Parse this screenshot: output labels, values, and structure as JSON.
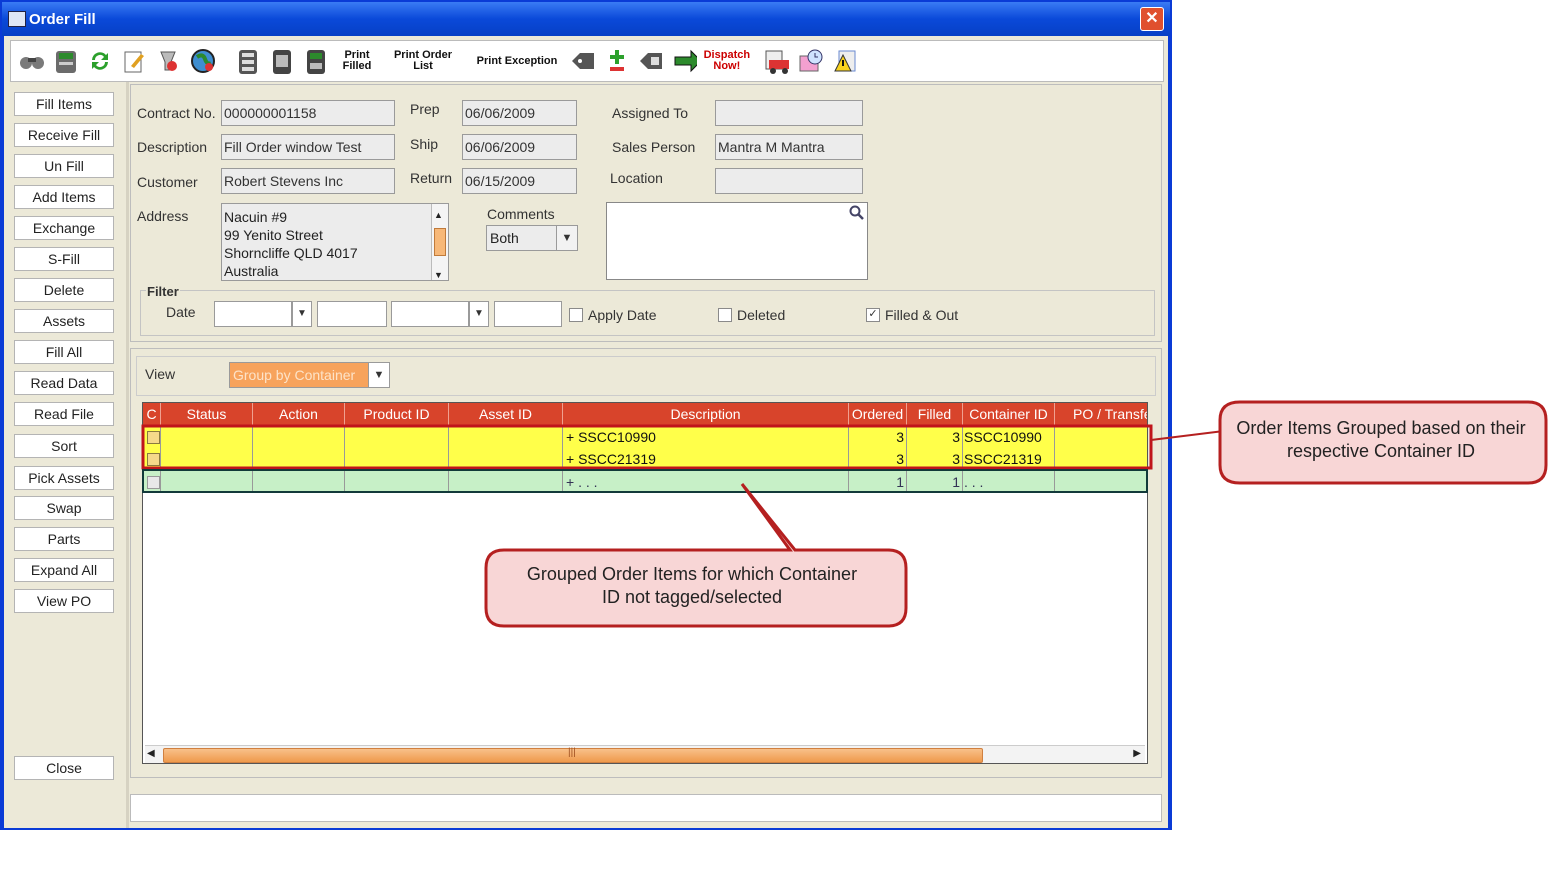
{
  "window": {
    "title": "Order Fill",
    "close_label": "✕"
  },
  "toolbar": {
    "print_filled": "Print Filled",
    "print_order_list": "Print Order List",
    "print_exception": "Print Exception",
    "dispatch_now": "Dispatch Now!"
  },
  "sidebar": {
    "fill_items": "Fill Items",
    "receive_fill": "Receive Fill",
    "un_fill": "Un Fill",
    "add_items": "Add Items",
    "exchange": "Exchange",
    "s_fill": "S-Fill",
    "delete": "Delete",
    "assets": "Assets",
    "fill_all": "Fill  All",
    "read_data": "Read Data",
    "read_file": "Read File",
    "sort": "Sort",
    "pick_assets": "Pick Assets",
    "swap": "Swap",
    "parts": "Parts",
    "expand_all": "Expand All",
    "view_po": "View PO",
    "close": "Close"
  },
  "form": {
    "contract_no_label": "Contract No.",
    "contract_no": "000000001158",
    "description_label": "Description",
    "description": "Fill Order window Test",
    "customer_label": "Customer",
    "customer": "Robert Stevens Inc",
    "address_label": "Address",
    "address_lines": [
      "Nacuin #9",
      "99 Yenito Street",
      "Shorncliffe QLD 4017",
      "Australia"
    ],
    "prep_label": "Prep",
    "prep": "06/06/2009",
    "ship_label": "Ship",
    "ship": "06/06/2009",
    "return_label": "Return",
    "return": "06/15/2009",
    "comments_label": "Comments",
    "comments_select": "Both",
    "assigned_to_label": "Assigned To",
    "assigned_to": "",
    "sales_person_label": "Sales Person",
    "sales_person": "Mantra M Mantra",
    "location_label": "Location",
    "location": ""
  },
  "filter": {
    "title": "Filter",
    "date_label": "Date",
    "apply_date": "Apply Date",
    "apply_date_checked": false,
    "deleted": "Deleted",
    "deleted_checked": false,
    "filled_out": "Filled & Out",
    "filled_out_checked": true
  },
  "view": {
    "label": "View",
    "selected": "Group by Container"
  },
  "grid": {
    "columns": [
      "C",
      "Status",
      "Action",
      "Product ID",
      "Asset ID",
      "Description",
      "Ordered",
      "Filled",
      "Container ID",
      "PO / Transfer"
    ],
    "rows": [
      {
        "description": "+ SSCC10990",
        "ordered": "3",
        "filled": "3",
        "container_id": "SSCC10990"
      },
      {
        "description": "+ SSCC21319",
        "ordered": "3",
        "filled": "3",
        "container_id": "SSCC21319"
      },
      {
        "description": "+ . . .",
        "ordered": "1",
        "filled": "1",
        "container_id": ". . ."
      }
    ],
    "scroll_grip": "|||"
  },
  "callouts": {
    "grouped_by_container": "Order Items Grouped based on their respective Container ID",
    "no_container": "Grouped Order Items for which Container ID not tagged/selected"
  },
  "colors": {
    "title_bar": "#0a49d9",
    "grid_header": "#d8442b",
    "group_row": "#ffff4a",
    "untagged_row": "#c7f0c7",
    "callout_fill": "#f8d6d6",
    "callout_border": "#b52020",
    "view_select": "#f7a35c"
  }
}
